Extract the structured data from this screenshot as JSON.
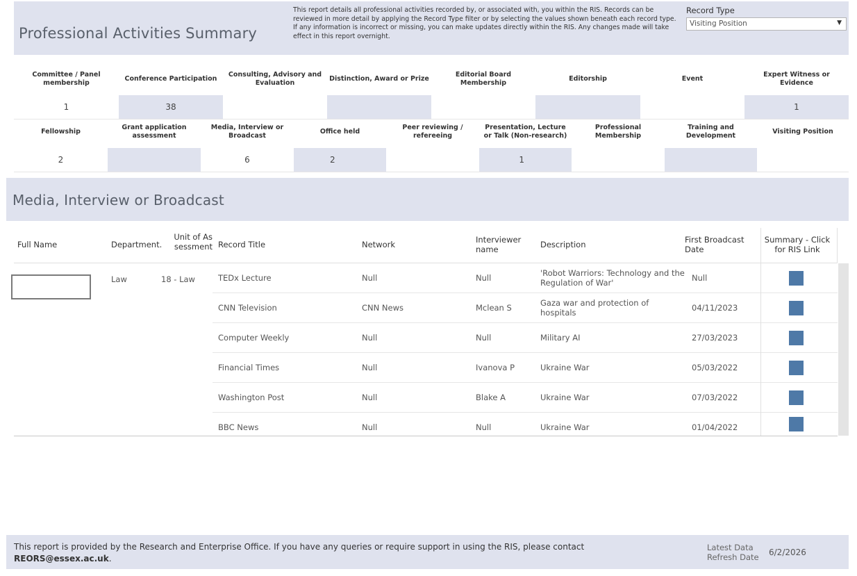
{
  "header": {
    "title": "Professional Activities Summary",
    "description": "This report details all professional activities recorded by, or associated with, you within the RIS. Records can be reviewed in more detail by applying the Record Type filter or by selecting the values shown beneath each record type. If any information is incorrect or missing, you can make updates directly within the RIS. Any changes made will take effect in this report overnight.",
    "record_type_label": "Record Type",
    "record_type_value": "Visiting Position"
  },
  "summary_row1": {
    "headers": [
      "Committee / Panel membership",
      "Conference Participation",
      "Consulting, Advisory and Evaluation",
      "Distinction, Award or Prize",
      "Editorial Board Membership",
      "Editorship",
      "Event",
      "Expert Witness or Evidence"
    ],
    "values": [
      "1",
      "38",
      "",
      "",
      "",
      "",
      "",
      "1"
    ]
  },
  "summary_row2": {
    "headers": [
      "Fellowship",
      "Grant application assessment",
      "Media, Interview or Broadcast",
      "Office held",
      "Peer reviewing / refereeing",
      "Presentation, Lecture or Talk (Non-research)",
      "Professional Membership",
      "Training and Development",
      "Visiting Position"
    ],
    "values": [
      "2",
      "",
      "6",
      "2",
      "",
      "1",
      "",
      "",
      ""
    ]
  },
  "section": {
    "title": "Media, Interview or Broadcast"
  },
  "table": {
    "columns": {
      "full_name": "Full Name",
      "department": "Department.",
      "unit": "Unit of As sessment",
      "record_title": "Record Title",
      "network": "Network",
      "interviewer": "Interviewer name",
      "description": "Description",
      "first_broadcast": "First Broadcast Date",
      "summary": "Summary - Click for RIS Link"
    },
    "department": "Law",
    "unit": "18 - Law",
    "rows": [
      {
        "title": "TEDx Lecture",
        "network": "Null",
        "interviewer": "Null",
        "description": "'Robot Warriors: Technology and the Regulation of War'",
        "date": "Null"
      },
      {
        "title": "CNN Television",
        "network": "CNN News",
        "interviewer": "Mclean S",
        "description": "Gaza war and protection of hospitals",
        "date": "04/11/2023"
      },
      {
        "title": "Computer Weekly",
        "network": "Null",
        "interviewer": "Null",
        "description": "Military AI",
        "date": "27/03/2023"
      },
      {
        "title": "Financial Times",
        "network": "Null",
        "interviewer": "Ivanova P",
        "description": "Ukraine War",
        "date": "05/03/2022"
      },
      {
        "title": "Washington Post",
        "network": "Null",
        "interviewer": "Blake A",
        "description": "Ukraine War",
        "date": "07/03/2022"
      },
      {
        "title": "BBC News",
        "network": "Null",
        "interviewer": "Null",
        "description": "Ukraine War",
        "date": "01/04/2022"
      }
    ]
  },
  "footer": {
    "text": "This report is provided by the Research and Enterprise Office. If you have any queries or require support in using the RIS, please contact",
    "email": "REORS@essex.ac.uk",
    "email_suffix": ".",
    "refresh_label": "Latest Data Refresh Date",
    "refresh_value": "6/2/2026"
  },
  "colors": {
    "band": "#dfe2ee",
    "link_square": "#4e79a7",
    "title_text": "#59606b"
  }
}
